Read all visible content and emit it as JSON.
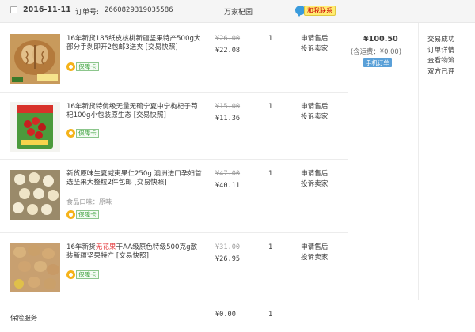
{
  "header": {
    "date": "2016-11-11",
    "order_label": "订单号:",
    "order_number": "2660829319035586",
    "shop_name": "万家杞园",
    "contact_label": "和我联系"
  },
  "items": [
    {
      "title": "16年新货185纸皮核桃新疆坚果特产500g大部分手剥即开2包邮3送夹 [交易快照]",
      "title_parts": [
        "16年新货185纸皮核桃新疆坚果特产500g大部分手剥即开2包邮3送夹 [交易快照]"
      ],
      "original_price": "¥26.00",
      "price": "¥22.08",
      "quantity": "1",
      "actions": [
        "申请售后",
        "投诉卖家"
      ],
      "badge": "保障卡",
      "thumb_icon": "walnut-photo-icon"
    },
    {
      "title": "16年新货特优级无量无硫宁夏中宁枸杞子苟杞100g小包装原生态 [交易快照]",
      "original_price": "¥15.00",
      "price": "¥11.36",
      "quantity": "1",
      "actions": [
        "申请售后",
        "投诉卖家"
      ],
      "badge": "保障卡",
      "thumb_icon": "goji-berry-photo-icon"
    },
    {
      "title": "新货原味生夏威夷果仁250g 澳洲进口孕妇首选坚果大整粒2件包邮 [交易快照]",
      "sku_label": "食品口味：原味",
      "original_price": "¥47.00",
      "price": "¥40.11",
      "quantity": "1",
      "actions": [
        "申请售后",
        "投诉卖家"
      ],
      "badge": "保障卡",
      "thumb_icon": "macadamia-photo-icon"
    },
    {
      "title_prefix": "16年新货",
      "title_highlight": "无花果",
      "title_suffix": "干AA级原色特级500克g散装新疆坚果特产 [交易快照]",
      "original_price": "¥31.00",
      "price": "¥26.95",
      "quantity": "1",
      "actions": [
        "申请售后",
        "投诉卖家"
      ],
      "badge": "保障卡",
      "thumb_icon": "dried-fig-photo-icon"
    }
  ],
  "summary": {
    "total": "¥100.50",
    "shipping": "(含运费：¥0.00)",
    "mobile_order": "手机订单"
  },
  "status_links": [
    "交易成功",
    "订单详情",
    "查看物流",
    "双方已评"
  ],
  "footer": {
    "label": "保险服务",
    "price": "¥0.00",
    "quantity": "1"
  },
  "colors": {
    "header_bg": "#f5f5f5",
    "highlight_red": "#e4393c",
    "mobile_badge": "#5aa0d8",
    "guarantee_green": "#3aa03a"
  }
}
